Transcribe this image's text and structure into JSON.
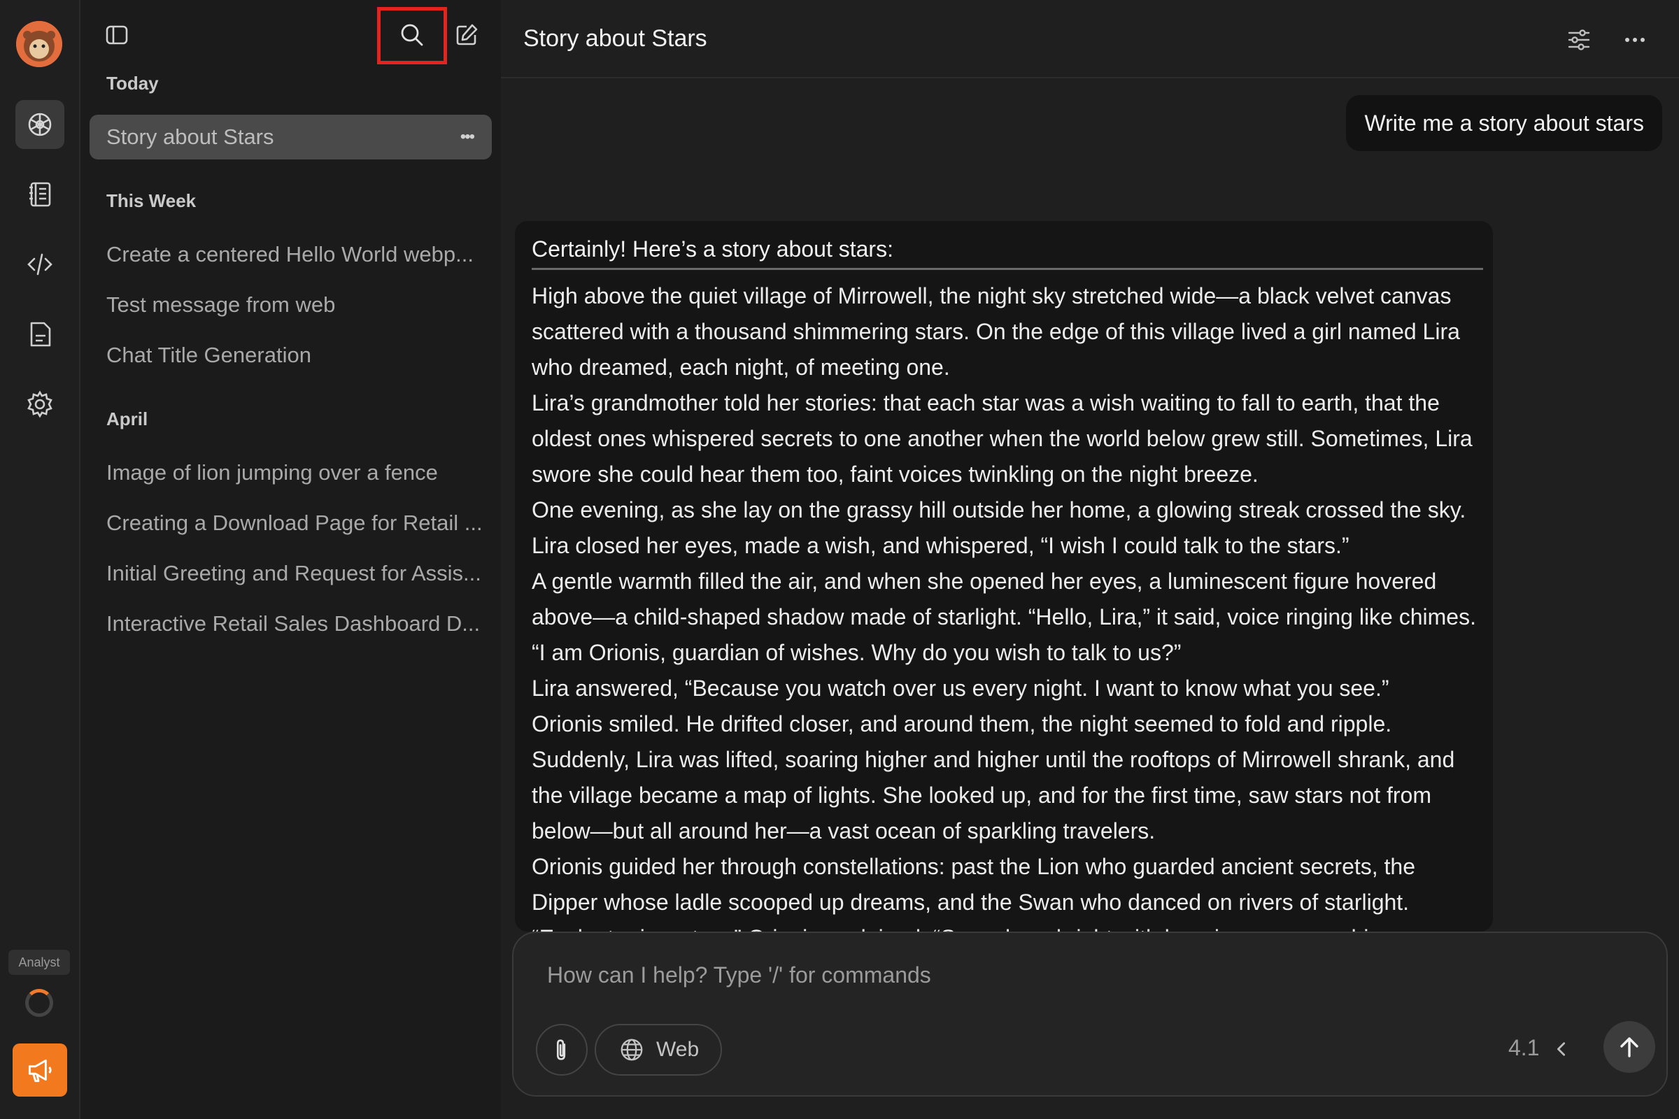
{
  "rail": {
    "badge_label": "Analyst",
    "icons": [
      "avatar-icon",
      "assistant-icon",
      "notebook-icon",
      "code-icon",
      "document-icon",
      "settings-icon",
      "announce-icon"
    ],
    "accent": "#f3791e"
  },
  "sidebar": {
    "sections": [
      {
        "title": "Today",
        "items": [
          {
            "label": "Story about Stars",
            "selected": true
          }
        ]
      },
      {
        "title": "This Week",
        "items": [
          {
            "label": "Create a centered Hello World webp..."
          },
          {
            "label": "Test message from web"
          },
          {
            "label": "Chat Title Generation"
          }
        ]
      },
      {
        "title": "April",
        "items": [
          {
            "label": "Image of lion jumping over a fence"
          },
          {
            "label": "Creating a Download Page for Retail ..."
          },
          {
            "label": "Initial Greeting and Request for Assis..."
          },
          {
            "label": "Interactive Retail Sales Dashboard D..."
          }
        ]
      }
    ],
    "item_menu_glyph": "•••"
  },
  "header": {
    "title": "Story about Stars"
  },
  "conversation": {
    "user_message": "Write me a story about stars",
    "assistant_intro": "Certainly! Here’s a story about stars:",
    "story_paragraphs": [
      "High above the quiet village of Mirrowell, the night sky stretched wide—a black velvet canvas scattered with a thousand shimmering stars. On the edge of this village lived a girl named Lira who dreamed, each night, of meeting one.",
      "Lira’s grandmother told her stories: that each star was a wish waiting to fall to earth, that the oldest ones whispered secrets to one another when the world below grew still. Sometimes, Lira swore she could hear them too, faint voices twinkling on the night breeze.",
      "One evening, as she lay on the grassy hill outside her home, a glowing streak crossed the sky. Lira closed her eyes, made a wish, and whispered, “I wish I could talk to the stars.”",
      "A gentle warmth filled the air, and when she opened her eyes, a luminescent figure hovered above—a child-shaped shadow made of starlight. “Hello, Lira,” it said, voice ringing like chimes. “I am Orionis, guardian of wishes. Why do you wish to talk to us?”",
      "Lira answered, “Because you watch over us every night. I want to know what you see.”",
      "Orionis smiled. He drifted closer, and around them, the night seemed to fold and ripple. Suddenly, Lira was lifted, soaring higher and higher until the rooftops of Mirrowell shrank, and the village became a map of lights. She looked up, and for the first time, saw stars not from below—but all around her—a vast ocean of sparkling travelers.",
      "Orionis guided her through constellations: past the Lion who guarded ancient secrets, the Dipper whose ladle scooped up dreams, and the Swan who danced on rivers of starlight.",
      "“Each star is a story,” Orionis explained. “Some burn bright with happiness, some shimmer"
    ]
  },
  "composer": {
    "placeholder": "How can I help? Type '/' for commands",
    "web_label": "Web",
    "model_version": "4.1"
  }
}
